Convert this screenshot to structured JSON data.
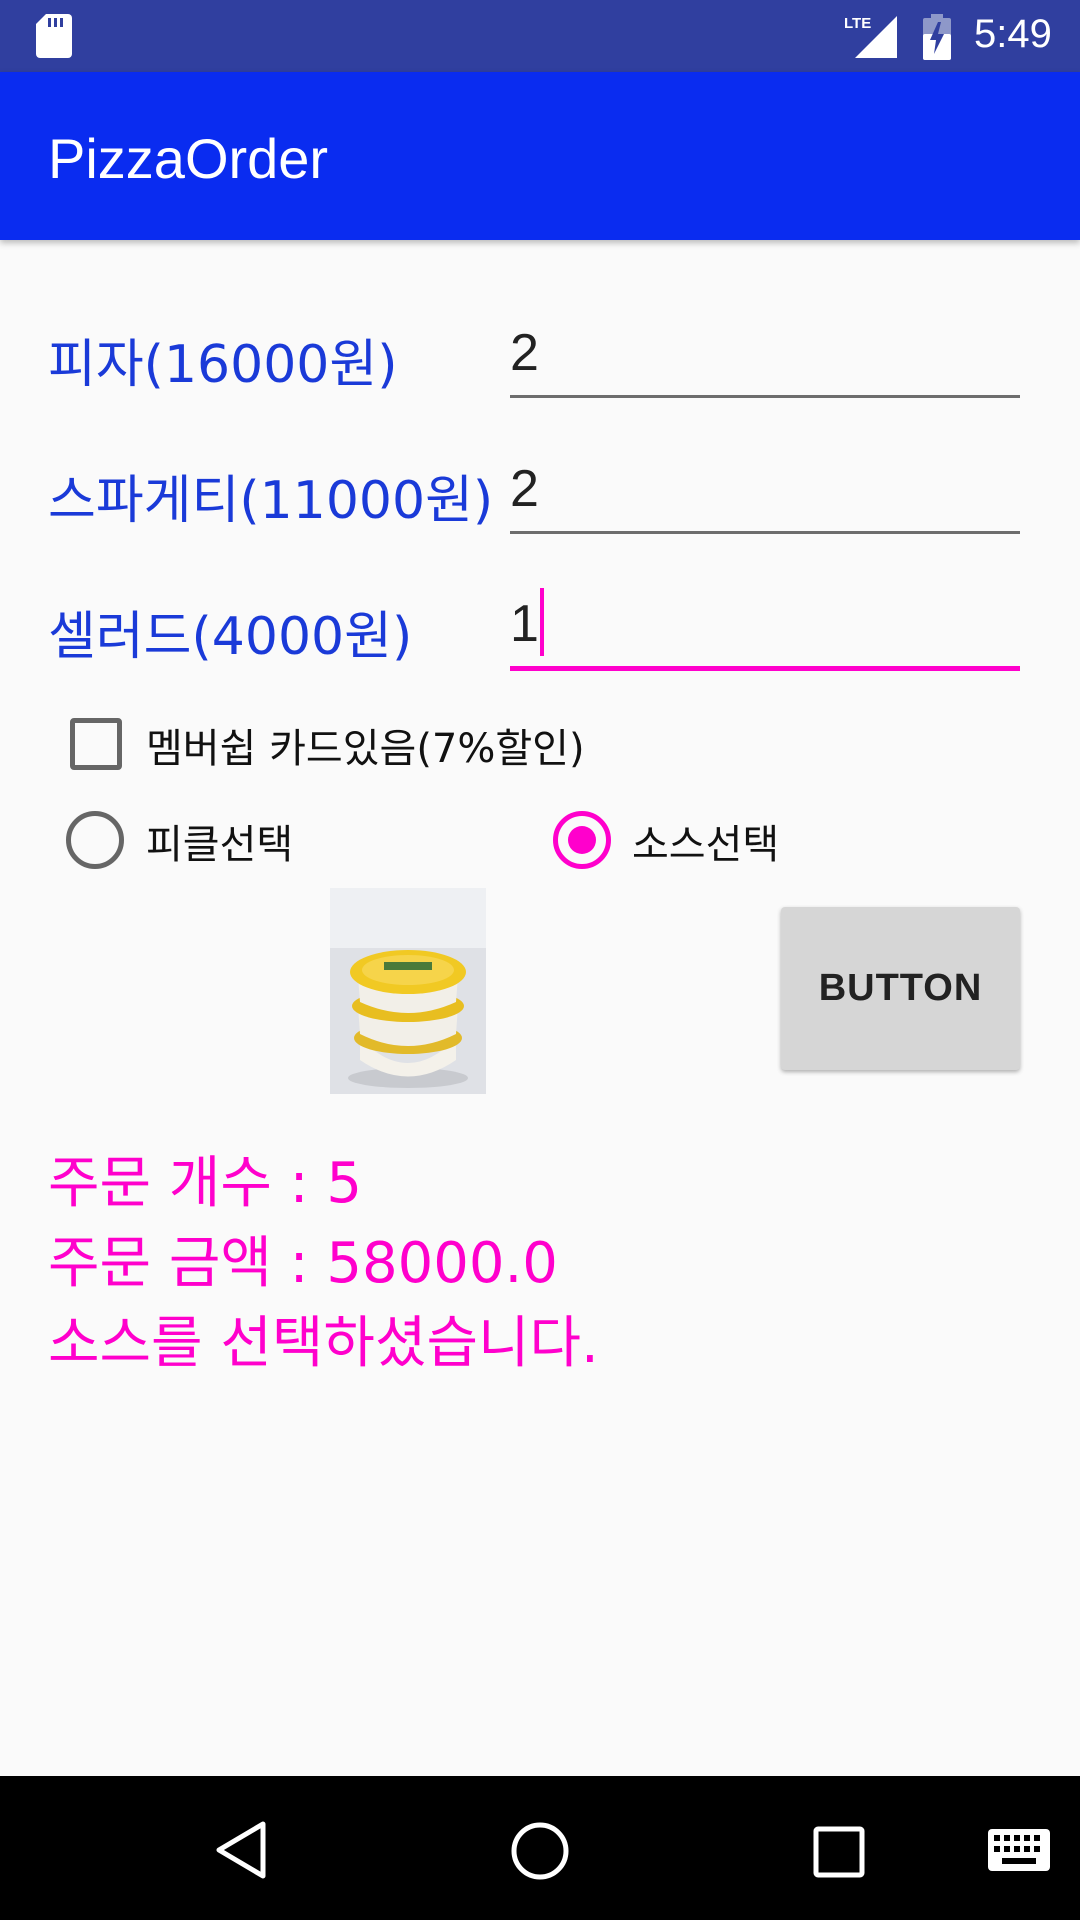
{
  "status_bar": {
    "time": "5:49",
    "network": "LTE",
    "icons": [
      "sd-card-icon",
      "lte-signal-icon",
      "battery-charging-icon"
    ]
  },
  "app_bar": {
    "title": "PizzaOrder"
  },
  "items": [
    {
      "label": "피자(16000원)",
      "quantity": "2"
    },
    {
      "label": "스파게티(11000원)",
      "quantity": "2"
    },
    {
      "label": "셀러드(4000원)",
      "quantity": "1"
    }
  ],
  "membership": {
    "label": "멤버쉽 카드있음(7%할인)",
    "checked": false
  },
  "options": [
    {
      "label": "피클선택",
      "selected": false
    },
    {
      "label": "소스선택",
      "selected": true
    }
  ],
  "image": {
    "subject": "sauce-cups-photo"
  },
  "button": {
    "label": "BUTTON"
  },
  "result": {
    "count_text": "주문 개수 : 5",
    "amount_text": "주문 금액 : 58000.0",
    "message": "소스를 선택하셨습니다."
  },
  "nav_bar": {
    "icons": [
      "back-icon",
      "home-icon",
      "recents-icon",
      "keyboard-icon"
    ]
  },
  "colors": {
    "status_bar": "#303f9f",
    "app_bar": "#0a2cf0",
    "label_blue": "#1a3ad8",
    "accent": "#ff00cc",
    "background": "#fafafa"
  }
}
